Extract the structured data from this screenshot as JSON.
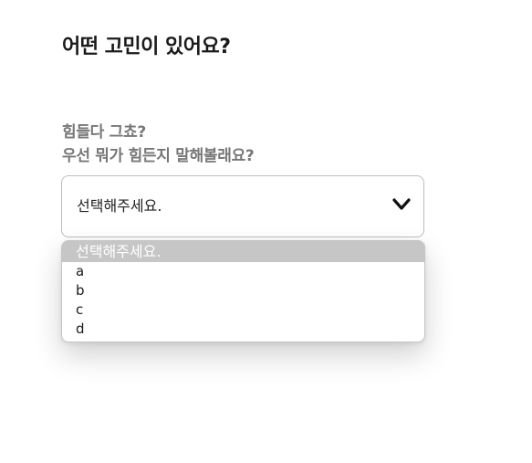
{
  "header": {
    "title": "어떤 고민이 있어요?"
  },
  "question": {
    "line1": "힘들다 그쵸?",
    "line2": "우선 뭐가 힘든지 말해볼래요?"
  },
  "select": {
    "value": "선택해주세요.",
    "icon": "chevron-down-icon",
    "options": [
      {
        "label": "선택해주세요.",
        "selected": true
      },
      {
        "label": "a",
        "selected": false
      },
      {
        "label": "b",
        "selected": false
      },
      {
        "label": "c",
        "selected": false
      },
      {
        "label": "d",
        "selected": false
      }
    ]
  },
  "colors": {
    "title": "#1a1a1a",
    "question": "#777777",
    "border": "#bdbdbd",
    "selected_option_bg": "#c6c6c6",
    "selected_option_text": "#ffffff"
  }
}
